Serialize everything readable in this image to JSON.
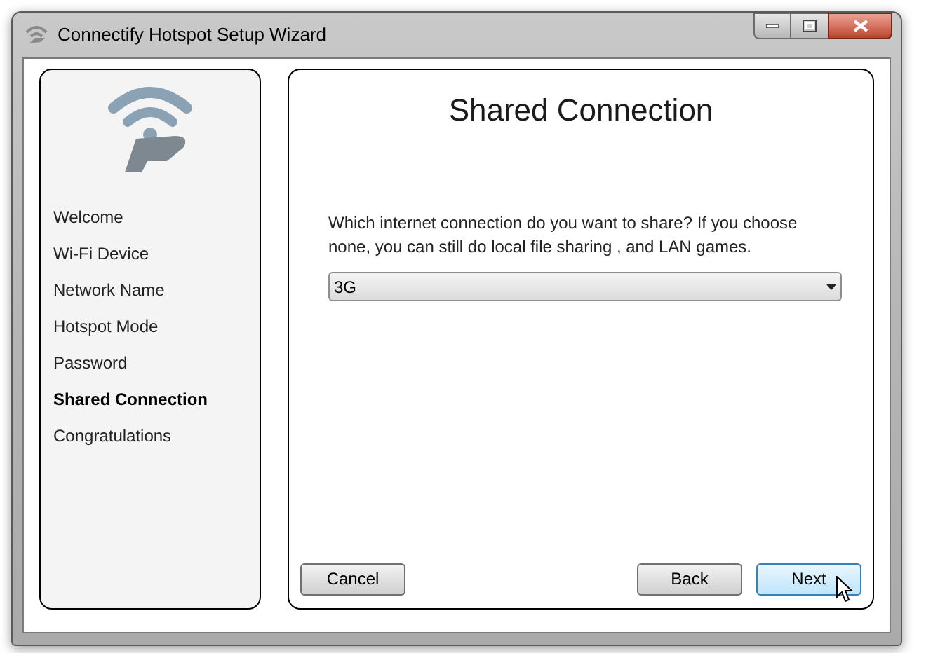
{
  "window": {
    "title": "Connectify Hotspot Setup Wizard"
  },
  "steps": [
    {
      "label": "Welcome",
      "selected": false
    },
    {
      "label": "Wi-Fi Device",
      "selected": false
    },
    {
      "label": "Network Name",
      "selected": false
    },
    {
      "label": "Hotspot Mode",
      "selected": false
    },
    {
      "label": "Password",
      "selected": false
    },
    {
      "label": "Shared Connection",
      "selected": true
    },
    {
      "label": "Congratulations",
      "selected": false
    }
  ],
  "page": {
    "heading": "Shared Connection",
    "description": "Which internet connection do you want to share? If you choose none, you can still do local file sharing , and LAN games.",
    "connection": {
      "value": "3G"
    }
  },
  "buttons": [
    {
      "label": "Cancel",
      "hovered": false
    },
    {
      "label": "Back",
      "hovered": false
    },
    {
      "label": "Next",
      "hovered": true
    }
  ]
}
